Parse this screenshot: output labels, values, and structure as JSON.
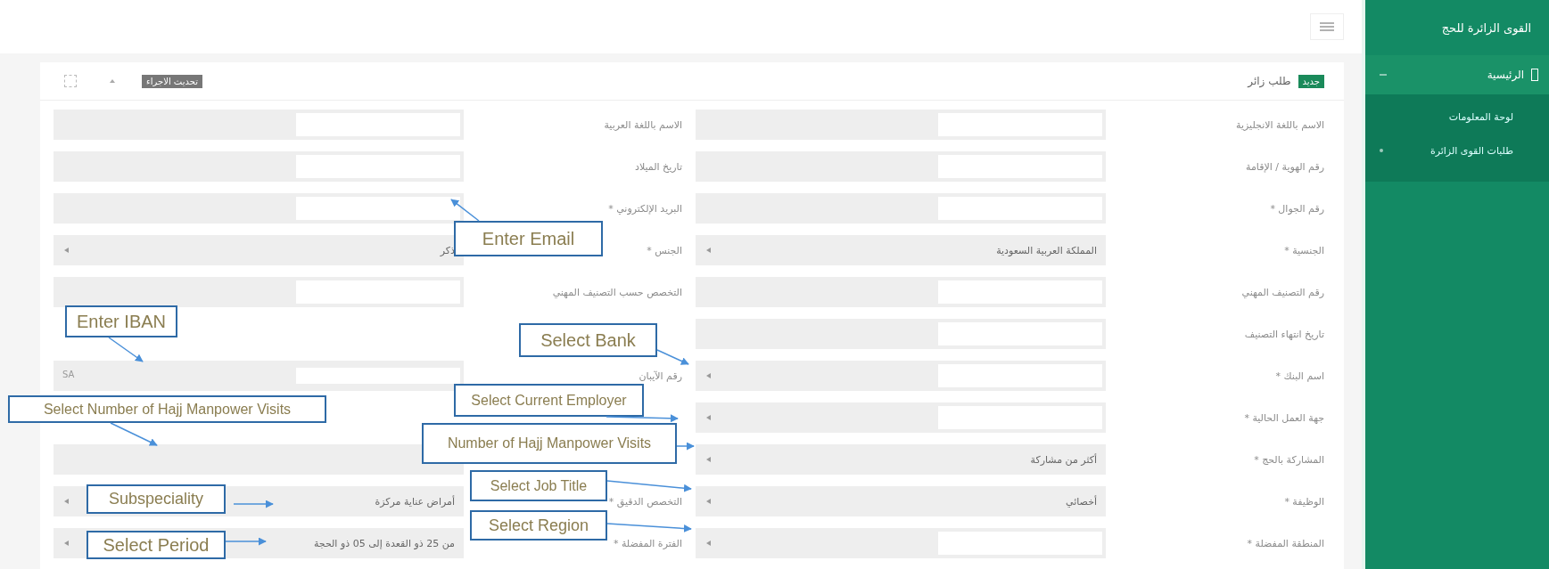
{
  "sidebar": {
    "title": "القوى الزائرة للحج",
    "items": [
      {
        "label": "الرئيسية",
        "expanded": true,
        "children": [
          {
            "label": "لوحة المعلومات"
          },
          {
            "label": "طلبات القوى الزائرة"
          }
        ]
      }
    ]
  },
  "card": {
    "badge": "جديد",
    "title": "طلب زائر",
    "action": "تحديث الاجراء"
  },
  "form": {
    "rows": [
      [
        {
          "kind": "input",
          "label": "الاسم باللغة الانجليزية"
        },
        {
          "kind": "input",
          "label": "الاسم باللغة العربية"
        }
      ],
      [
        {
          "kind": "input",
          "label": "رقم الهوية / الإقامة"
        },
        {
          "kind": "input",
          "label": "تاريخ الميلاد"
        }
      ],
      [
        {
          "kind": "input",
          "label": "رقم الجوال *"
        },
        {
          "kind": "input",
          "label": "البريد الإلكتروني *"
        }
      ],
      [
        {
          "kind": "select",
          "label": "الجنسية *",
          "value": "المملكة العربية السعودية"
        },
        {
          "kind": "select",
          "label": "الجنس *",
          "value": "ذكر"
        }
      ],
      [
        {
          "kind": "input",
          "label": "رقم التصنيف المهني"
        },
        {
          "kind": "input",
          "label": "التخصص حسب التصنيف المهني"
        }
      ],
      [
        {
          "kind": "input",
          "label": "تاريخ انتهاء التصنيف"
        },
        {
          "kind": "blank"
        }
      ],
      [
        {
          "kind": "select-input",
          "label": "اسم البنك *"
        },
        {
          "kind": "prefixed",
          "label": "رقم الآيبان",
          "prefix": "SA"
        }
      ],
      [
        {
          "kind": "select-input",
          "label": "جهة العمل الحالية *"
        },
        {
          "kind": "blank"
        }
      ],
      [
        {
          "kind": "select",
          "label": "المشاركة بالحج *",
          "value": "أكثر من مشاركة"
        },
        {
          "kind": "plain"
        }
      ],
      [
        {
          "kind": "select",
          "label": "الوظيفة *",
          "value": "أخصائي"
        },
        {
          "kind": "select",
          "label": "التخصص الدقيق *",
          "value": "أمراض عناية مركزة"
        }
      ],
      [
        {
          "kind": "select-input",
          "label": "المنطقة المفضلة *"
        },
        {
          "kind": "select",
          "label": "الفترة المفضلة *",
          "value": "من 25 ذو القعدة إلى 05 ذو الحجة"
        }
      ]
    ]
  },
  "callouts": [
    {
      "text": "Enter Email"
    },
    {
      "text": "Enter IBAN"
    },
    {
      "text": "Select Bank"
    },
    {
      "text": "Select Current Employer"
    },
    {
      "text": "Select Number of  Hajj Manpower Visits"
    },
    {
      "text": "Number of  Hajj Manpower Visits"
    },
    {
      "text": "Subspeciality"
    },
    {
      "text": "Select Job Title"
    },
    {
      "text": "Select Period"
    },
    {
      "text": "Select Region"
    }
  ]
}
